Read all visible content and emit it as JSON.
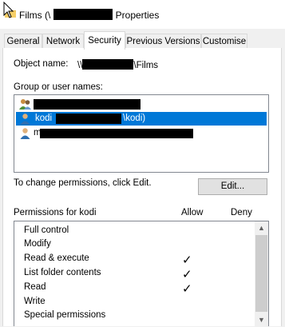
{
  "window": {
    "title_prefix": "Films (\\",
    "title_suffix": " Properties"
  },
  "tabs": [
    {
      "label": "General",
      "active": false
    },
    {
      "label": "Network",
      "active": false
    },
    {
      "label": "Security",
      "active": true
    },
    {
      "label": "Previous Versions",
      "active": false
    },
    {
      "label": "Customise",
      "active": false
    }
  ],
  "object": {
    "label": "Object name:",
    "value_prefix": "\\\\",
    "value_suffix": "\\Films"
  },
  "users": {
    "label": "Group or user names:",
    "items": [
      {
        "text": "",
        "selected": false,
        "icon": "group-users-icon"
      },
      {
        "text": "kodi",
        "suffix": "\\kodi)",
        "selected": true,
        "icon": "user-icon"
      },
      {
        "text": "m",
        "selected": false,
        "icon": "user-icon"
      }
    ]
  },
  "edit": {
    "hint": "To change permissions, click Edit.",
    "button_label": "Edit..."
  },
  "permissions": {
    "title": "Permissions for kodi",
    "allow_header": "Allow",
    "deny_header": "Deny",
    "rows": [
      {
        "name": "Full control",
        "allow": false,
        "deny": false
      },
      {
        "name": "Modify",
        "allow": false,
        "deny": false
      },
      {
        "name": "Read & execute",
        "allow": true,
        "deny": false
      },
      {
        "name": "List folder contents",
        "allow": true,
        "deny": false
      },
      {
        "name": "Read",
        "allow": true,
        "deny": false
      },
      {
        "name": "Write",
        "allow": false,
        "deny": false
      },
      {
        "name": "Special permissions",
        "allow": false,
        "deny": false
      }
    ]
  },
  "colors": {
    "selection": "#0078d7",
    "folder": "#e8b84a"
  }
}
